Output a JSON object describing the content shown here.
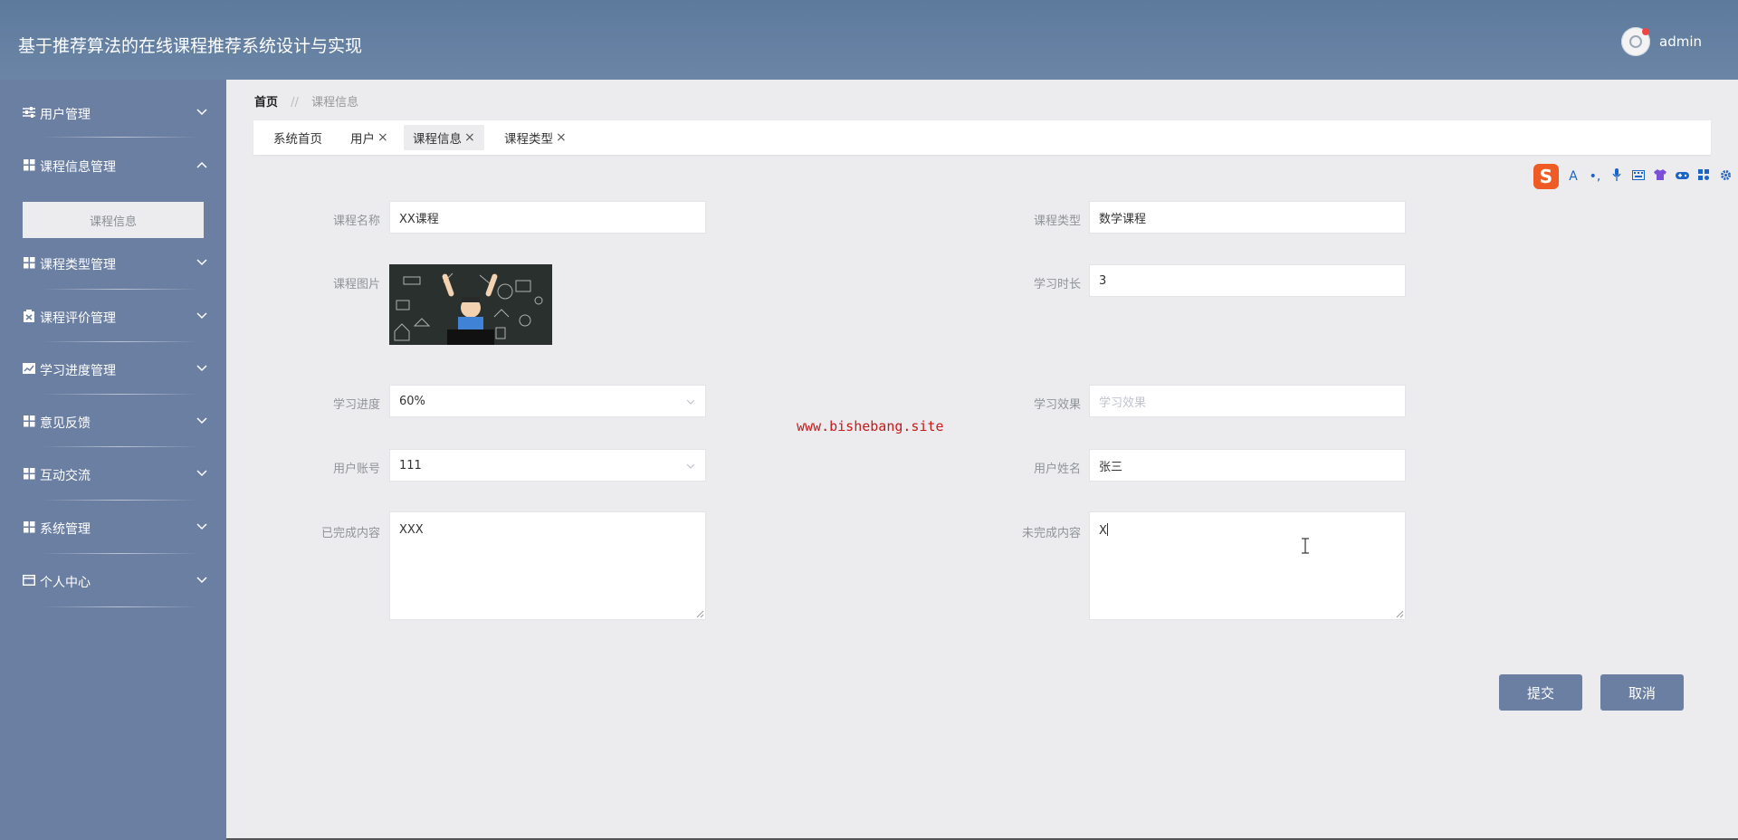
{
  "app": {
    "title": "基于推荐算法的在线课程推荐系统设计与实现"
  },
  "user": {
    "name": "admin"
  },
  "sidebar": {
    "items": [
      {
        "label": "用户管理",
        "icon": "sliders-icon",
        "expanded": false
      },
      {
        "label": "课程信息管理",
        "icon": "grid-icon",
        "expanded": true,
        "children": [
          {
            "label": "课程信息",
            "active": true
          }
        ]
      },
      {
        "label": "课程类型管理",
        "icon": "grid-icon",
        "expanded": false
      },
      {
        "label": "课程评价管理",
        "icon": "clipboard-icon",
        "expanded": false
      },
      {
        "label": "学习进度管理",
        "icon": "chart-icon",
        "expanded": false
      },
      {
        "label": "意见反馈",
        "icon": "grid-icon",
        "expanded": false
      },
      {
        "label": "互动交流",
        "icon": "grid-icon",
        "expanded": false
      },
      {
        "label": "系统管理",
        "icon": "grid-icon",
        "expanded": false
      },
      {
        "label": "个人中心",
        "icon": "card-icon",
        "expanded": false
      }
    ]
  },
  "breadcrumb": {
    "home": "首页",
    "separator": "//",
    "current": "课程信息"
  },
  "tabs": [
    {
      "label": "系统首页",
      "closable": false,
      "active": false
    },
    {
      "label": "用户",
      "closable": true,
      "active": false
    },
    {
      "label": "课程信息",
      "closable": true,
      "active": true
    },
    {
      "label": "课程类型",
      "closable": true,
      "active": false
    }
  ],
  "form": {
    "course_name": {
      "label": "课程名称",
      "value": "XX课程"
    },
    "course_type": {
      "label": "课程类型",
      "value": "数学课程"
    },
    "course_image": {
      "label": "课程图片"
    },
    "study_duration": {
      "label": "学习时长",
      "value": "3"
    },
    "study_progress": {
      "label": "学习进度",
      "value": "60%"
    },
    "study_effect": {
      "label": "学习效果",
      "placeholder": "学习效果"
    },
    "user_account": {
      "label": "用户账号",
      "value": "111"
    },
    "user_name": {
      "label": "用户姓名",
      "value": "张三"
    },
    "completed_content": {
      "label": "已完成内容",
      "value": "XXX"
    },
    "incomplete_content": {
      "label": "未完成内容",
      "value": "X"
    }
  },
  "watermark": "www.bishebang.site",
  "buttons": {
    "submit": "提交",
    "cancel": "取消"
  },
  "ime": {
    "logo": "S",
    "buttons": [
      "A",
      "•,",
      "mic-icon",
      "keyboard-icon",
      "shirt-icon",
      "gamepad-icon",
      "apps-icon",
      "settings-icon"
    ]
  },
  "colors": {
    "header": "#6b85a6",
    "sidebar": "#6b7fa3",
    "button": "#6b7fa3",
    "watermark": "#c51b1b",
    "ime": "#ef5b25"
  }
}
